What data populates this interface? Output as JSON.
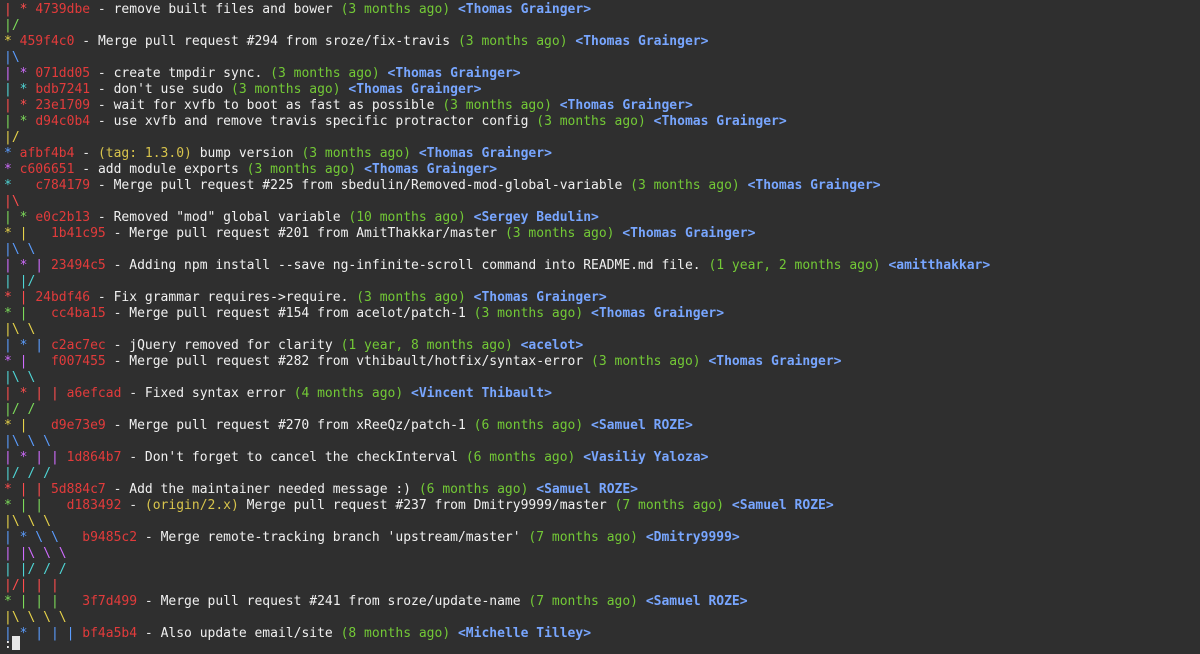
{
  "terminal": {
    "commits": [
      {
        "graph": "| * ",
        "hash": "4739dbe",
        "tag": "",
        "message": "remove built files and bower",
        "date": "(3 months ago)",
        "author": "<Thomas Grainger>"
      },
      {
        "graph": "|/",
        "hash": "",
        "tag": "",
        "message": "",
        "date": "",
        "author": ""
      },
      {
        "graph": "* ",
        "hash": "459f4c0",
        "tag": "",
        "message": "Merge pull request #294 from sroze/fix-travis",
        "date": "(3 months ago)",
        "author": "<Thomas Grainger>"
      },
      {
        "graph": "|\\",
        "hash": "",
        "tag": "",
        "message": "",
        "date": "",
        "author": ""
      },
      {
        "graph": "| * ",
        "hash": "071dd05",
        "tag": "",
        "message": "create tmpdir sync.",
        "date": "(3 months ago)",
        "author": "<Thomas Grainger>"
      },
      {
        "graph": "| * ",
        "hash": "bdb7241",
        "tag": "",
        "message": "don't use sudo",
        "date": "(3 months ago)",
        "author": "<Thomas Grainger>"
      },
      {
        "graph": "| * ",
        "hash": "23e1709",
        "tag": "",
        "message": "wait for xvfb to boot as fast as possible",
        "date": "(3 months ago)",
        "author": "<Thomas Grainger>"
      },
      {
        "graph": "| * ",
        "hash": "d94c0b4",
        "tag": "",
        "message": "use xvfb and remove travis specific protractor config",
        "date": "(3 months ago)",
        "author": "<Thomas Grainger>"
      },
      {
        "graph": "|/",
        "hash": "",
        "tag": "",
        "message": "",
        "date": "",
        "author": ""
      },
      {
        "graph": "* ",
        "hash": "afbf4b4",
        "tag": "(tag: 1.3.0)",
        "message": "bump version",
        "date": "(3 months ago)",
        "author": "<Thomas Grainger>"
      },
      {
        "graph": "* ",
        "hash": "c606651",
        "tag": "",
        "message": "add module exports",
        "date": "(3 months ago)",
        "author": "<Thomas Grainger>"
      },
      {
        "graph": "*   ",
        "hash": "c784179",
        "tag": "",
        "message": "Merge pull request #225 from sbedulin/Removed-mod-global-variable",
        "date": "(3 months ago)",
        "author": "<Thomas Grainger>"
      },
      {
        "graph": "|\\",
        "hash": "",
        "tag": "",
        "message": "",
        "date": "",
        "author": ""
      },
      {
        "graph": "| * ",
        "hash": "e0c2b13",
        "tag": "",
        "message": "Removed \"mod\" global variable",
        "date": "(10 months ago)",
        "author": "<Sergey Bedulin>"
      },
      {
        "graph": "* |   ",
        "hash": "1b41c95",
        "tag": "",
        "message": "Merge pull request #201 from AmitThakkar/master",
        "date": "(3 months ago)",
        "author": "<Thomas Grainger>"
      },
      {
        "graph": "|\\ \\",
        "hash": "",
        "tag": "",
        "message": "",
        "date": "",
        "author": ""
      },
      {
        "graph": "| * | ",
        "hash": "23494c5",
        "tag": "",
        "message": "Adding npm install --save ng-infinite-scroll command into README.md file.",
        "date": "(1 year, 2 months ago)",
        "author": "<amitthakkar>"
      },
      {
        "graph": "| |/",
        "hash": "",
        "tag": "",
        "message": "",
        "date": "",
        "author": ""
      },
      {
        "graph": "* | ",
        "hash": "24bdf46",
        "tag": "",
        "message": "Fix grammar requires->require.",
        "date": "(3 months ago)",
        "author": "<Thomas Grainger>"
      },
      {
        "graph": "* |   ",
        "hash": "cc4ba15",
        "tag": "",
        "message": "Merge pull request #154 from acelot/patch-1",
        "date": "(3 months ago)",
        "author": "<Thomas Grainger>"
      },
      {
        "graph": "|\\ \\",
        "hash": "",
        "tag": "",
        "message": "",
        "date": "",
        "author": ""
      },
      {
        "graph": "| * | ",
        "hash": "c2ac7ec",
        "tag": "",
        "message": "jQuery removed for clarity",
        "date": "(1 year, 8 months ago)",
        "author": "<acelot>"
      },
      {
        "graph": "* |   ",
        "hash": "f007455",
        "tag": "",
        "message": "Merge pull request #282 from vthibault/hotfix/syntax-error",
        "date": "(3 months ago)",
        "author": "<Thomas Grainger>"
      },
      {
        "graph": "|\\ \\ ",
        "hash": "",
        "tag": "",
        "message": "",
        "date": "",
        "author": ""
      },
      {
        "graph": "| * | | ",
        "hash": "a6efcad",
        "tag": "",
        "message": "Fixed syntax error",
        "date": "(4 months ago)",
        "author": "<Vincent Thibault>"
      },
      {
        "graph": "|/ /",
        "hash": "",
        "tag": "",
        "message": "",
        "date": "",
        "author": ""
      },
      {
        "graph": "* |   ",
        "hash": "d9e73e9",
        "tag": "",
        "message": "Merge pull request #270 from xReeQz/patch-1",
        "date": "(6 months ago)",
        "author": "<Samuel ROZE>"
      },
      {
        "graph": "|\\ \\ \\",
        "hash": "",
        "tag": "",
        "message": "",
        "date": "",
        "author": ""
      },
      {
        "graph": "| * | | ",
        "hash": "1d864b7",
        "tag": "",
        "message": "Don't forget to cancel the checkInterval",
        "date": "(6 months ago)",
        "author": "<Vasiliy Yaloza>"
      },
      {
        "graph": "|/ / /",
        "hash": "",
        "tag": "",
        "message": "",
        "date": "",
        "author": ""
      },
      {
        "graph": "* | | ",
        "hash": "5d884c7",
        "tag": "",
        "message": "Add the maintainer needed message :)",
        "date": "(6 months ago)",
        "author": "<Samuel ROZE>"
      },
      {
        "graph": "* | |   ",
        "hash": "d183492",
        "tag": "(origin/2.x)",
        "message": "Merge pull request #237 from Dmitry9999/master",
        "date": "(7 months ago)",
        "author": "<Samuel ROZE>"
      },
      {
        "graph": "|\\ \\ \\",
        "hash": "",
        "tag": "",
        "message": "",
        "date": "",
        "author": ""
      },
      {
        "graph": "| * \\ \\   ",
        "hash": "b9485c2",
        "tag": "",
        "message": "Merge remote-tracking branch 'upstream/master'",
        "date": "(7 months ago)",
        "author": "<Dmitry9999>"
      },
      {
        "graph": "| |\\ \\ \\",
        "hash": "",
        "tag": "",
        "message": "",
        "date": "",
        "author": ""
      },
      {
        "graph": "| |/ / /",
        "hash": "",
        "tag": "",
        "message": "",
        "date": "",
        "author": ""
      },
      {
        "graph": "|/| | |",
        "hash": "",
        "tag": "",
        "message": "",
        "date": "",
        "author": ""
      },
      {
        "graph": "* | | |   ",
        "hash": "3f7d499",
        "tag": "",
        "message": "Merge pull request #241 from sroze/update-name",
        "date": "(7 months ago)",
        "author": "<Samuel ROZE>"
      },
      {
        "graph": "|\\ \\ \\ \\",
        "hash": "",
        "tag": "",
        "message": "",
        "date": "",
        "author": ""
      },
      {
        "graph": "| * | | | ",
        "hash": "bf4a5b4",
        "tag": "",
        "message": "Also update email/site",
        "date": "(8 months ago)",
        "author": "<Michelle Tilley>"
      }
    ],
    "prompt": ":"
  }
}
